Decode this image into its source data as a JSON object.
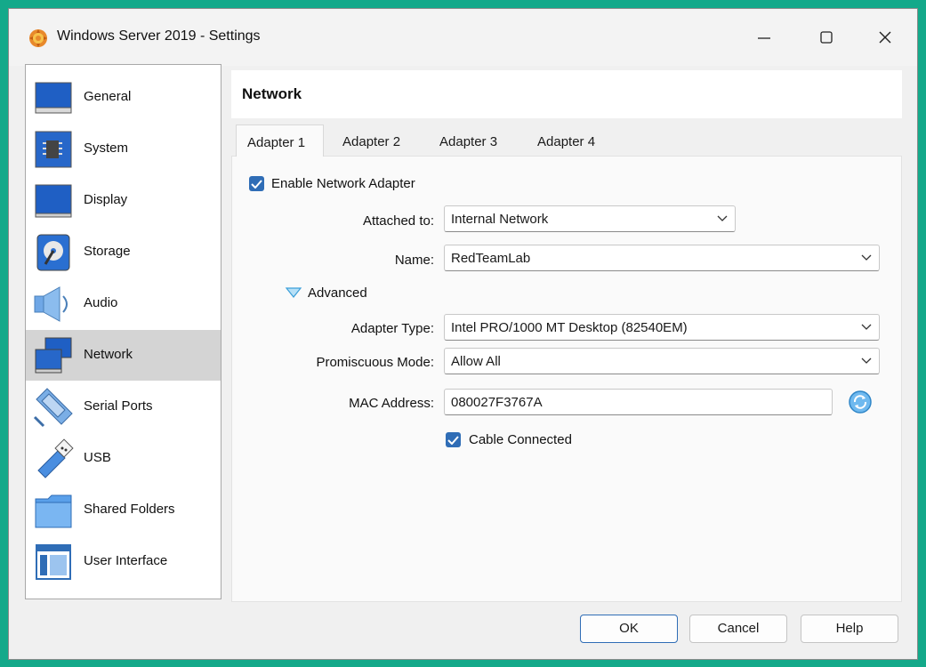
{
  "window": {
    "title": "Windows Server 2019 - Settings",
    "icons": {
      "app": "virtualbox-icon",
      "minimize": "minimize-icon",
      "maximize": "maximize-icon",
      "close": "close-icon"
    }
  },
  "sidebar": {
    "items": [
      {
        "label": "General",
        "icon": "general-icon"
      },
      {
        "label": "System",
        "icon": "system-icon"
      },
      {
        "label": "Display",
        "icon": "display-icon"
      },
      {
        "label": "Storage",
        "icon": "storage-icon"
      },
      {
        "label": "Audio",
        "icon": "audio-icon"
      },
      {
        "label": "Network",
        "icon": "network-icon",
        "selected": true
      },
      {
        "label": "Serial Ports",
        "icon": "serial-ports-icon"
      },
      {
        "label": "USB",
        "icon": "usb-icon"
      },
      {
        "label": "Shared Folders",
        "icon": "shared-folders-icon"
      },
      {
        "label": "User Interface",
        "icon": "user-interface-icon"
      }
    ]
  },
  "panel": {
    "title": "Network",
    "tabs": [
      {
        "label": "Adapter 1",
        "active": true
      },
      {
        "label": "Adapter 2"
      },
      {
        "label": "Adapter 3"
      },
      {
        "label": "Adapter 4"
      }
    ]
  },
  "adapter": {
    "enable_label": "Enable Network Adapter",
    "enable_checked": true,
    "attached_to_label": "Attached to:",
    "attached_to_value": "Internal Network",
    "name_label": "Name:",
    "name_value": "RedTeamLab",
    "advanced_label": "Advanced",
    "adapter_type_label": "Adapter Type:",
    "adapter_type_value": "Intel PRO/1000 MT Desktop (82540EM)",
    "promiscuous_label": "Promiscuous Mode:",
    "promiscuous_value": "Allow All",
    "mac_label": "MAC Address:",
    "mac_value": "080027F3767A",
    "cable_label": "Cable Connected",
    "cable_checked": true
  },
  "buttons": {
    "ok": "OK",
    "cancel": "Cancel",
    "help": "Help"
  },
  "colors": {
    "accent": "#2f6db6",
    "frame": "#14a98a",
    "selected_row": "#d4d4d4"
  }
}
